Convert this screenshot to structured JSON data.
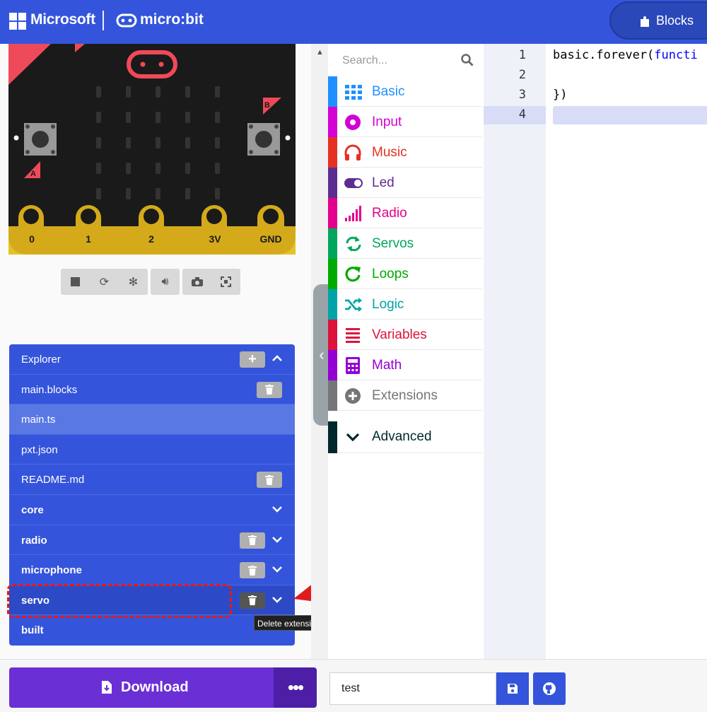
{
  "header": {
    "brand": "Microsoft",
    "product": "micro:bit",
    "blocks_tab": "Blocks"
  },
  "simulator": {
    "pins": [
      "0",
      "1",
      "2",
      "3V",
      "GND"
    ],
    "button_a": "A",
    "button_b": "B",
    "toolbar": [
      "stop",
      "restart",
      "debug",
      "mute",
      "screenshot",
      "fullscreen"
    ]
  },
  "explorer": {
    "title": "Explorer",
    "items": [
      {
        "label": "main.blocks"
      },
      {
        "label": "main.ts"
      },
      {
        "label": "pxt.json"
      },
      {
        "label": "README.md"
      },
      {
        "label": "core"
      },
      {
        "label": "radio"
      },
      {
        "label": "microphone"
      },
      {
        "label": "servo"
      },
      {
        "label": "built"
      }
    ],
    "tooltip": "Delete extension servo"
  },
  "toolbox": {
    "search_placeholder": "Search...",
    "categories": [
      {
        "label": "Basic",
        "color": "#1e90ff"
      },
      {
        "label": "Input",
        "color": "#d400d4"
      },
      {
        "label": "Music",
        "color": "#e63022"
      },
      {
        "label": "Led",
        "color": "#5c2d91"
      },
      {
        "label": "Radio",
        "color": "#e3008c"
      },
      {
        "label": "Servos",
        "color": "#00a65c"
      },
      {
        "label": "Loops",
        "color": "#00aa00"
      },
      {
        "label": "Logic",
        "color": "#00a4a6"
      },
      {
        "label": "Variables",
        "color": "#dc143c"
      },
      {
        "label": "Math",
        "color": "#9400d3"
      },
      {
        "label": "Extensions",
        "color": "#757575"
      },
      {
        "label": "Advanced",
        "color": "#00272b"
      }
    ]
  },
  "editor": {
    "line_numbers": [
      "1",
      "2",
      "3",
      "4"
    ],
    "line1_prefix": "basic.forever(",
    "line1_kw": "functi",
    "line3": "})"
  },
  "bottom": {
    "download_label": "Download",
    "more_label": "•••",
    "project_name": "test"
  }
}
